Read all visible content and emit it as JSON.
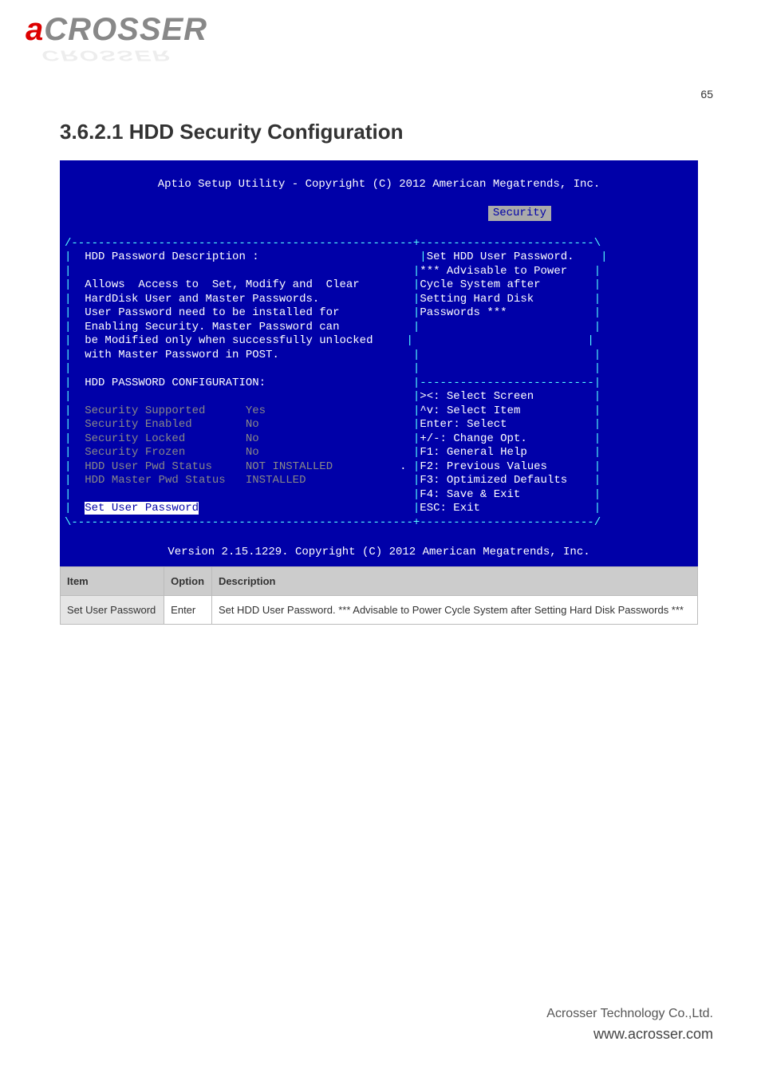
{
  "logo": {
    "first": "a",
    "rest": "CROSSER",
    "shadow": "CROSSER"
  },
  "page_number_top": "65",
  "section_title": "3.6.2.1 HDD Security Configuration",
  "bios": {
    "header": "Aptio Setup Utility - Copyright (C) 2012 American Megatrends, Inc.",
    "tab": "Security",
    "left": {
      "title": "HDD Password Description :",
      "desc1": "Allows  Access to  Set, Modify and  Clear",
      "desc2": "HardDisk User and Master Passwords.",
      "desc3": "User Password need to be installed for",
      "desc4": "Enabling Security. Master Password can",
      "desc5": "be Modified only when successfully unlocked",
      "desc6": "with Master Password in POST.",
      "cfg_title": "HDD PASSWORD CONFIGURATION:",
      "rows": [
        {
          "label": "Security Supported",
          "value": "Yes"
        },
        {
          "label": "Security Enabled",
          "value": "No"
        },
        {
          "label": "Security Locked",
          "value": "No"
        },
        {
          "label": "Security Frozen",
          "value": "No"
        },
        {
          "label": "HDD User Pwd Status",
          "value": "NOT INSTALLED"
        },
        {
          "label": "HDD Master Pwd Status",
          "value": "INSTALLED"
        }
      ],
      "selected": "Set User Password"
    },
    "help": {
      "l1": "Set HDD User Password.",
      "l2": "*** Advisable to Power",
      "l3": "Cycle System after",
      "l4": "Setting Hard Disk",
      "l5": "Passwords ***"
    },
    "keys": {
      "k1": "><: Select Screen",
      "k2": "^v: Select Item",
      "k3": "Enter: Select",
      "k4": "+/-: Change Opt.",
      "k5": "F1: General Help",
      "k6": "F2: Previous Values",
      "k7": "F3: Optimized Defaults",
      "k8": "F4: Save & Exit",
      "k9": "ESC: Exit"
    },
    "footer": "Version 2.15.1229. Copyright (C) 2012 American Megatrends, Inc."
  },
  "table": {
    "headers": [
      "Item",
      "Option",
      "Description"
    ],
    "row": {
      "item": "Set User Password",
      "option": "Enter",
      "desc": "Set HDD User Password. *** Advisable to Power Cycle System after Setting Hard Disk Passwords ***"
    }
  },
  "footer": {
    "company": "Acrosser Technology Co.,Ltd.",
    "url": "www.acrosser.com"
  }
}
